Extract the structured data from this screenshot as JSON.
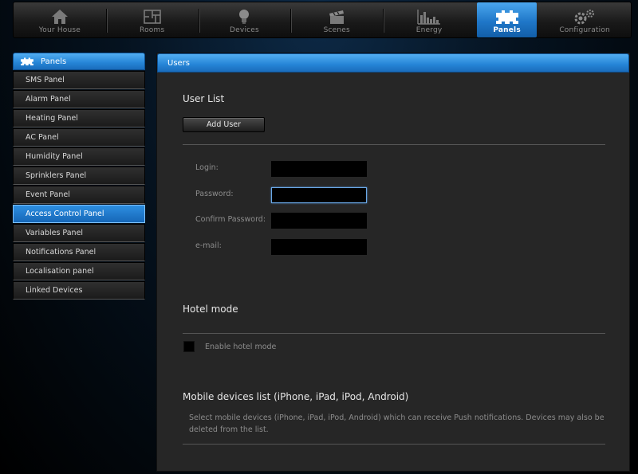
{
  "nav": {
    "items": [
      {
        "label": "Your House",
        "icon": "house-icon"
      },
      {
        "label": "Rooms",
        "icon": "rooms-icon"
      },
      {
        "label": "Devices",
        "icon": "lightbulb-icon"
      },
      {
        "label": "Scenes",
        "icon": "clapperboard-icon"
      },
      {
        "label": "Energy",
        "icon": "bar-chart-icon"
      },
      {
        "label": "Panels",
        "icon": "puzzle-icon",
        "active": true
      },
      {
        "label": "Configuration",
        "icon": "gears-icon"
      }
    ]
  },
  "sidebar": {
    "title": "Panels",
    "items": [
      {
        "label": "SMS Panel"
      },
      {
        "label": "Alarm Panel"
      },
      {
        "label": "Heating Panel"
      },
      {
        "label": "AC Panel"
      },
      {
        "label": "Humidity Panel"
      },
      {
        "label": "Sprinklers Panel"
      },
      {
        "label": "Event Panel"
      },
      {
        "label": "Access Control Panel",
        "active": true
      },
      {
        "label": "Variables Panel"
      },
      {
        "label": "Notifications Panel"
      },
      {
        "label": "Localisation panel"
      },
      {
        "label": "Linked Devices"
      }
    ]
  },
  "main": {
    "header": "Users",
    "user_list": {
      "title": "User List",
      "add_button": "Add User"
    },
    "form": {
      "login_label": "Login:",
      "login_value": "",
      "password_label": "Password:",
      "password_value": "",
      "confirm_label": "Confirm Password:",
      "confirm_value": "",
      "email_label": "e-mail:",
      "email_value": ""
    },
    "hotel": {
      "title": "Hotel mode",
      "checkbox_label": "Enable hotel mode",
      "checked": false
    },
    "mobile": {
      "title": "Mobile devices list (iPhone, iPad, iPod, Android)",
      "description": "Select mobile devices (iPhone, iPad, iPod, Android) which can receive Push notifications. Devices may also be deleted from the list."
    }
  },
  "colors": {
    "accent": "#2584d6",
    "panel_bg": "#262626",
    "page_bg": "#000000"
  }
}
